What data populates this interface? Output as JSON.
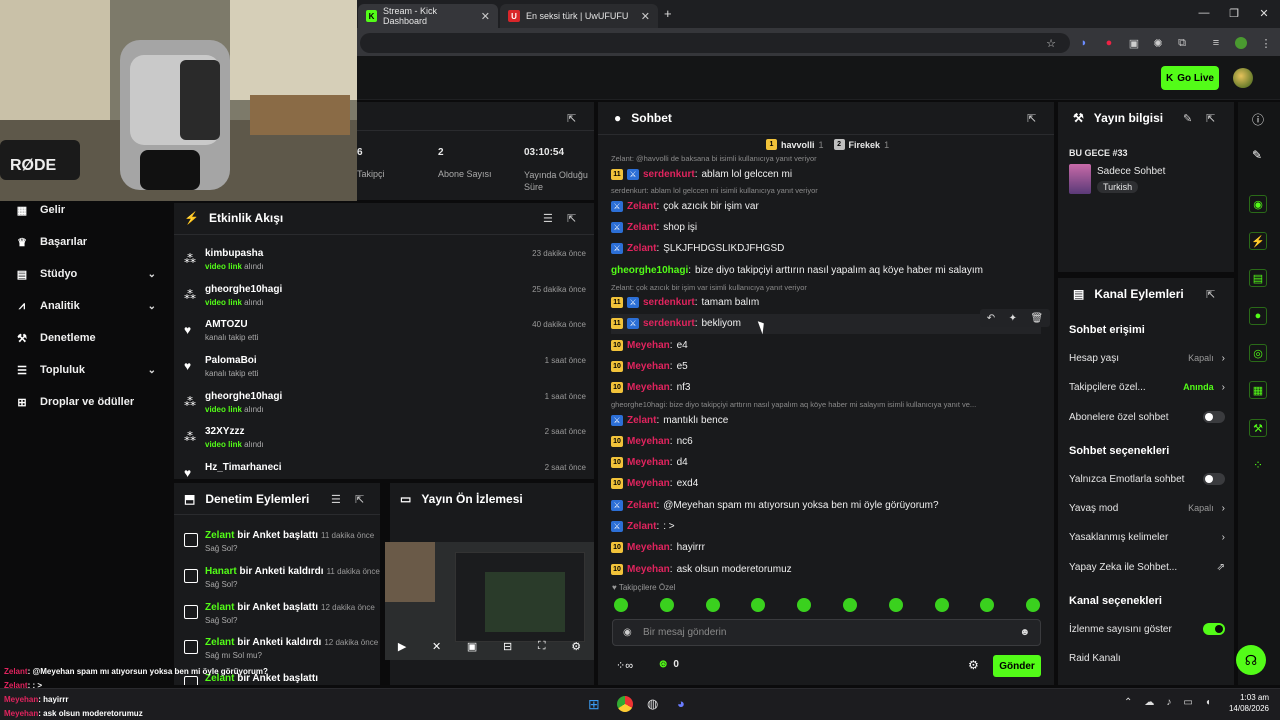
{
  "browser": {
    "tabs": [
      {
        "title": "Stream - Kick Dashboard"
      },
      {
        "title": "En seksi türk | UwUFUFU",
        "favicon_letter": "U"
      }
    ]
  },
  "header": {
    "go_live_label": "Go Live"
  },
  "stats": [
    {
      "value": "6",
      "label": "Takipçi"
    },
    {
      "value": "2",
      "label": "Abone Sayısı"
    },
    {
      "value": "03:10:54",
      "label": "Yayında Olduğu Süre"
    }
  ],
  "nav": {
    "items": [
      {
        "label": "Gelir",
        "icon": "chart-icon"
      },
      {
        "label": "Başarılar",
        "icon": "trophy-icon"
      },
      {
        "label": "Stüdyo",
        "icon": "studio-icon",
        "expandable": true
      },
      {
        "label": "Analitik",
        "icon": "analytics-icon",
        "expandable": true
      },
      {
        "label": "Denetleme",
        "icon": "wrench-icon"
      },
      {
        "label": "Topluluk",
        "icon": "community-icon",
        "expandable": true
      },
      {
        "label": "Droplar ve ödüller",
        "icon": "drops-icon"
      }
    ]
  },
  "activity": {
    "title": "Etkinlik Akışı",
    "items": [
      {
        "name": "kimbupasha",
        "action_highlight": "video link",
        "action_rest": "alındı",
        "time": "23 dakika önce",
        "icon": "link-icon"
      },
      {
        "name": "gheorghe10hagi",
        "action_highlight": "video link",
        "action_rest": "alındı",
        "time": "25 dakika önce",
        "icon": "link-icon"
      },
      {
        "name": "AMTOZU",
        "action_highlight": "",
        "action_rest": "kanalı takip etti",
        "time": "40 dakika önce",
        "icon": "heart-icon"
      },
      {
        "name": "PalomaBoi",
        "action_highlight": "",
        "action_rest": "kanalı takip etti",
        "time": "1 saat önce",
        "icon": "heart-icon"
      },
      {
        "name": "gheorghe10hagi",
        "action_highlight": "video link",
        "action_rest": "alındı",
        "time": "1 saat önce",
        "icon": "link-icon"
      },
      {
        "name": "32XYzzz",
        "action_highlight": "video link",
        "action_rest": "alındı",
        "time": "2 saat önce",
        "icon": "link-icon"
      },
      {
        "name": "Hz_Timarhaneci",
        "action_highlight": "",
        "action_rest": "",
        "time": "2 saat önce",
        "icon": "heart-icon"
      }
    ]
  },
  "moderation": {
    "title": "Denetim Eylemleri",
    "items": [
      {
        "user": "Zelant",
        "action": "bir Anket başlattı",
        "time": "11 dakika önce",
        "detail": "Sağ Sol?"
      },
      {
        "user": "Hanart",
        "action": "bir Anketi kaldırdı",
        "time": "11 dakika önce",
        "detail": "Sağ Sol?"
      },
      {
        "user": "Zelant",
        "action": "bir Anket başlattı",
        "time": "12 dakika önce",
        "detail": "Sağ Sol?"
      },
      {
        "user": "Zelant",
        "action": "bir Anketi kaldırdı",
        "time": "12 dakika önce",
        "detail": "Sağ mı Sol mu?"
      },
      {
        "user": "Zelant",
        "action": "bir Anket başlattı",
        "time": "",
        "detail": ""
      }
    ]
  },
  "preview": {
    "title": "Yayın Ön İzlemesi"
  },
  "chat": {
    "title": "Sohbet",
    "pinned": [
      {
        "rank": "1",
        "name": "havvolli",
        "count": "1"
      },
      {
        "rank": "2",
        "name": "Firekek",
        "count": "1"
      }
    ],
    "lines": [
      {
        "type": "reply",
        "text": "Zelant: @havvolli de baksana bi isimli kullanıcıya yanıt veriyor"
      },
      {
        "type": "msg",
        "sub": "11",
        "mod": true,
        "user": "serdenkurt",
        "color": "#e0245e",
        "text": "ablam lol gelccen mi"
      },
      {
        "type": "reply",
        "text": "serdenkurt: ablam lol gelccen mi isimli kullanıcıya yanıt veriyor"
      },
      {
        "type": "msg",
        "sub": "",
        "mod": true,
        "user": "Zelant",
        "color": "#e0245e",
        "text": "çok azıcık bir işim var"
      },
      {
        "type": "msg",
        "sub": "",
        "mod": true,
        "user": "Zelant",
        "color": "#e0245e",
        "text": "shop işi"
      },
      {
        "type": "msg",
        "sub": "",
        "mod": true,
        "user": "Zelant",
        "color": "#e0245e",
        "text": "ŞLKJFHDGSLIKDJFHGSD"
      },
      {
        "type": "msg",
        "sub": "",
        "mod": false,
        "user": "gheorghe10hagi",
        "color": "#53fc18",
        "text": "bize diyo takipçiyi arttırın nasıl yapalım aq köye haber mi salayım"
      },
      {
        "type": "reply",
        "text": "Zelant: çok azıcık bir işim var isimli kullanıcıya yanıt veriyor"
      },
      {
        "type": "msg",
        "sub": "11",
        "mod": true,
        "user": "serdenkurt",
        "color": "#e0245e",
        "text": "tamam balım"
      },
      {
        "type": "msg",
        "sub": "11",
        "mod": true,
        "user": "serdenkurt",
        "color": "#e0245e",
        "text": "bekliyom",
        "hover": true
      },
      {
        "type": "msg",
        "sub": "10",
        "mod": false,
        "user": "Meyehan",
        "color": "#e0245e",
        "text": "e4"
      },
      {
        "type": "msg",
        "sub": "10",
        "mod": false,
        "user": "Meyehan",
        "color": "#e0245e",
        "text": "e5"
      },
      {
        "type": "msg",
        "sub": "10",
        "mod": false,
        "user": "Meyehan",
        "color": "#e0245e",
        "text": "nf3"
      },
      {
        "type": "reply",
        "text": "gheorghe10hagi: bize diyo takipçiyi arttırın nasıl yapalım aq köye haber mi salayım isimli kullanıcıya yanıt ve..."
      },
      {
        "type": "msg",
        "sub": "",
        "mod": true,
        "user": "Zelant",
        "color": "#e0245e",
        "text": "mantıklı bence"
      },
      {
        "type": "msg",
        "sub": "10",
        "mod": false,
        "user": "Meyehan",
        "color": "#e0245e",
        "text": "nc6"
      },
      {
        "type": "msg",
        "sub": "10",
        "mod": false,
        "user": "Meyehan",
        "color": "#e0245e",
        "text": "d4"
      },
      {
        "type": "msg",
        "sub": "10",
        "mod": false,
        "user": "Meyehan",
        "color": "#e0245e",
        "text": "exd4"
      },
      {
        "type": "msg",
        "sub": "",
        "mod": true,
        "user": "Zelant",
        "color": "#e0245e",
        "text": "@Meyehan spam mı atıyorsun yoksa ben mi öyle görüyorum?"
      },
      {
        "type": "msg",
        "sub": "",
        "mod": true,
        "user": "Zelant",
        "color": "#e0245e",
        "text": ": >"
      },
      {
        "type": "msg",
        "sub": "10",
        "mod": false,
        "user": "Meyehan",
        "color": "#e0245e",
        "text": "hayirrr"
      },
      {
        "type": "msg",
        "sub": "10",
        "mod": false,
        "user": "Meyehan",
        "color": "#e0245e",
        "text": "ask olsun moderetorumuz"
      }
    ],
    "followers_only_label": "Takipçilere Özel",
    "input_placeholder": "Bir mesaj gönderin",
    "points": "0",
    "send_label": "Gönder"
  },
  "stream_info": {
    "title": "Yayın bilgisi",
    "stream_title": "BU GECE #33",
    "category": "Sadece Sohbet",
    "language": "Turkish"
  },
  "channel_actions": {
    "title": "Kanal Eylemleri",
    "chat_access_heading": "Sohbet erişimi",
    "account_age_label": "Hesap yaşı",
    "account_age_value": "Kapalı",
    "followers_only_label": "Takipçilere özel...",
    "followers_only_value": "Anında",
    "subs_only_label": "Abonelere özel sohbet",
    "chat_options_heading": "Sohbet seçenekleri",
    "emote_only_label": "Yalnızca Emotlarla sohbet",
    "slow_mode_label": "Yavaş mod",
    "slow_mode_value": "Kapalı",
    "banned_words_label": "Yasaklanmış kelimeler",
    "ai_chat_label": "Yapay Zeka ile Sohbet...",
    "channel_options_heading": "Kanal seçenekleri",
    "show_viewers_label": "İzlenme sayısını göster",
    "raid_label": "Raid Kanalı"
  },
  "overlay": {
    "lines": [
      {
        "user": "Zelant",
        "text": ": @Meyehan spam mı atıyorsun yoksa ben mi öyle görüyorum?"
      },
      {
        "user": "Zelant",
        "text": ": : >"
      },
      {
        "user": "Meyehan",
        "text": ": hayirrr"
      },
      {
        "user": "Meyehan",
        "text": ": ask olsun moderetorumuz"
      }
    ]
  },
  "taskbar": {
    "time": "1:03 am",
    "date": "14/08/2026"
  },
  "colors": {
    "accent": "#53fc18",
    "panel": "#191a1c",
    "username_red": "#e0245e",
    "mod_badge": "#2c6fd6",
    "sub_badge": "#f2c33a"
  }
}
